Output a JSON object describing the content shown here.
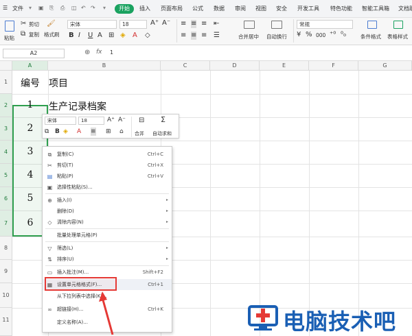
{
  "menubar": {
    "file": "文件",
    "tabs": [
      "开始",
      "插入",
      "页面布局",
      "公式",
      "数据",
      "审阅",
      "视图",
      "安全",
      "开发工具",
      "特色功能",
      "智能工具箱",
      "文档助"
    ]
  },
  "ribbon": {
    "paste": "粘贴",
    "cut": "剪切",
    "copy": "复制",
    "format_painter": "格式刷",
    "font_name": "宋体",
    "font_size": "18",
    "merge": "合并居中",
    "wrap": "自动换行",
    "number_format": "常规",
    "cond_format": "条件格式",
    "table_style": "表格样式",
    "bold": "B",
    "italic": "I",
    "underline": "U",
    "percent": "%",
    "thousands": "000"
  },
  "formula_bar": {
    "cell_ref": "A2",
    "fx": "fx",
    "value": "1"
  },
  "columns": [
    "A",
    "B",
    "C",
    "D",
    "E",
    "F",
    "G"
  ],
  "rows": [
    "1",
    "2",
    "3",
    "4",
    "5",
    "6",
    "7",
    "8",
    "9",
    "10",
    "11"
  ],
  "cells": {
    "a1": "编号",
    "b1": "项目",
    "numbers": [
      "1",
      "2",
      "3",
      "4",
      "5",
      "6"
    ],
    "b2": "生产记录档案"
  },
  "mini_toolbar": {
    "font": "宋体",
    "size": "18",
    "bold": "B",
    "merge": "合并",
    "autosum": "自动求和"
  },
  "context_menu": {
    "items": [
      {
        "label": "复制(C)",
        "shortcut": "Ctrl+C",
        "icon": "copy-icon"
      },
      {
        "label": "剪切(T)",
        "shortcut": "Ctrl+X",
        "icon": "scissors-icon"
      },
      {
        "label": "粘贴(P)",
        "shortcut": "Ctrl+V",
        "icon": "paste-icon"
      },
      {
        "label": "选择性粘贴(S)...",
        "shortcut": "",
        "icon": "paste-special-icon"
      },
      {
        "label": "插入(I)",
        "shortcut": "",
        "icon": "insert-icon",
        "submenu": true
      },
      {
        "label": "删除(D)",
        "shortcut": "",
        "icon": "",
        "submenu": true
      },
      {
        "label": "清除内容(N)",
        "shortcut": "",
        "icon": "eraser-icon",
        "submenu": true
      },
      {
        "label": "批量处理单元格(P)",
        "shortcut": "",
        "icon": ""
      },
      {
        "label": "筛选(L)",
        "shortcut": "",
        "icon": "filter-icon",
        "submenu": true
      },
      {
        "label": "排序(U)",
        "shortcut": "",
        "icon": "sort-icon",
        "submenu": true
      },
      {
        "label": "插入批注(M)...",
        "shortcut": "Shift+F2",
        "icon": "comment-icon"
      },
      {
        "label": "设置单元格格式(F)...",
        "shortcut": "Ctrl+1",
        "icon": "format-cells-icon"
      },
      {
        "label": "从下拉列表中选择(K)...",
        "shortcut": "",
        "icon": ""
      },
      {
        "label": "超链接(H)...",
        "shortcut": "Ctrl+K",
        "icon": "link-icon"
      },
      {
        "label": "定义名称(A)...",
        "shortcut": "",
        "icon": ""
      }
    ]
  },
  "watermark": {
    "text": "电脑技术吧"
  },
  "colors": {
    "accent": "#1aa260",
    "selection": "#2e9f4e",
    "highlight": "#e53935",
    "watermark": "#1a5fb4"
  }
}
